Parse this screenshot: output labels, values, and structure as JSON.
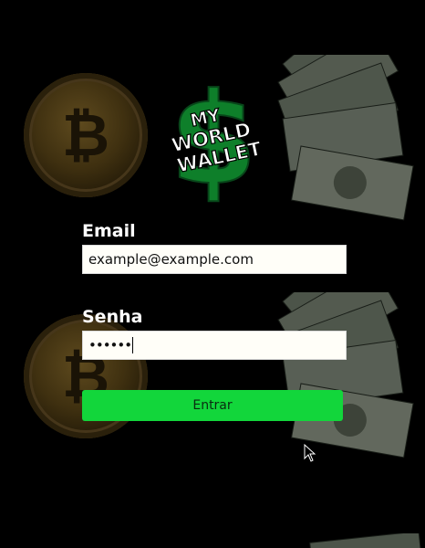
{
  "app": {
    "logo_text": [
      "MY",
      "WORLD",
      "WALLET"
    ],
    "accent_color": "#12d63b",
    "logo_color": "#0e7f2a"
  },
  "form": {
    "email_label": "Email",
    "email_value": "example@example.com",
    "password_label": "Senha",
    "password_value": "••••••",
    "submit_label": "Entrar"
  },
  "background": {
    "icons": [
      "bitcoin-coin-icon",
      "dollar-bills-icon",
      "bitcoin-coin-icon",
      "dollar-bills-icon",
      "dollar-bills-icon"
    ]
  }
}
